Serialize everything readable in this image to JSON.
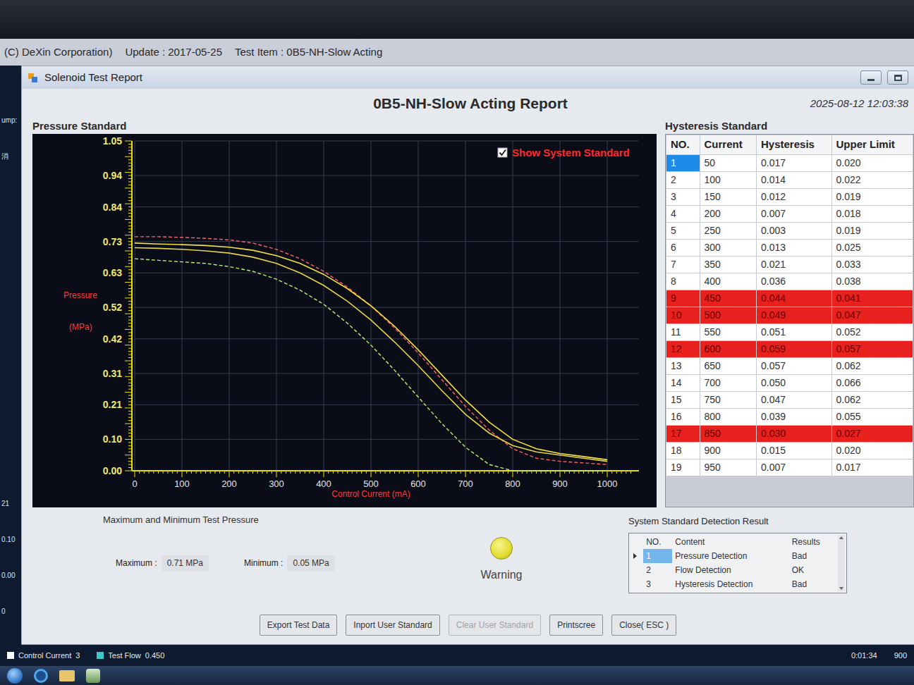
{
  "app_title": [
    "(C) DeXin Corporation)",
    "Update : 2017-05-25",
    "Test Item : 0B5-NH-Slow Acting"
  ],
  "background": {
    "left_top": [
      "ump:",
      "消"
    ],
    "left_bottom": [
      "21",
      "0.10",
      "0.00",
      "0"
    ],
    "legend": [
      {
        "label": "Control Current",
        "value": "3",
        "color": "#ffffff"
      },
      {
        "label": "Test Flow",
        "value": "0.450",
        "color": "#3cc8c8"
      }
    ],
    "right_labels": [
      "0:01:34",
      "900"
    ]
  },
  "window": {
    "title": "Solenoid Test Report"
  },
  "report": {
    "title": "0B5-NH-Slow Acting Report",
    "date": "2025-08-12 12:03:38"
  },
  "chart": {
    "title": "Pressure Standard",
    "y_label": [
      "Pressure",
      "(MPa)"
    ],
    "x_label": "Control Current (mA)",
    "y_ticks": [
      "1.05",
      "0.94",
      "0.84",
      "0.73",
      "0.63",
      "0.52",
      "0.42",
      "0.31",
      "0.21",
      "0.10",
      "0.00"
    ],
    "x_ticks": [
      "0",
      "100",
      "200",
      "300",
      "400",
      "500",
      "600",
      "700",
      "800",
      "900",
      "1000"
    ],
    "checkbox": {
      "label": "Show System Standard",
      "checked": true
    },
    "x_values": [
      0,
      50,
      100,
      150,
      200,
      250,
      300,
      350,
      400,
      450,
      500,
      550,
      600,
      650,
      700,
      750,
      800,
      850,
      900,
      950,
      1000
    ],
    "series": [
      {
        "kind": "dashed",
        "color": "#ff6060",
        "values": [
          0.745,
          0.745,
          0.743,
          0.74,
          0.735,
          0.725,
          0.705,
          0.675,
          0.635,
          0.585,
          0.525,
          0.455,
          0.375,
          0.29,
          0.205,
          0.13,
          0.07,
          0.04,
          0.03,
          0.025,
          0.02
        ]
      },
      {
        "kind": "solid",
        "color": "#f0e040",
        "values": [
          0.725,
          0.722,
          0.72,
          0.717,
          0.712,
          0.702,
          0.685,
          0.66,
          0.625,
          0.58,
          0.525,
          0.46,
          0.385,
          0.305,
          0.225,
          0.155,
          0.1,
          0.07,
          0.055,
          0.045,
          0.035
        ]
      },
      {
        "kind": "solid",
        "color": "#e4d44c",
        "values": [
          0.71,
          0.708,
          0.705,
          0.7,
          0.693,
          0.68,
          0.66,
          0.63,
          0.59,
          0.54,
          0.48,
          0.41,
          0.335,
          0.255,
          0.18,
          0.12,
          0.08,
          0.06,
          0.05,
          0.04,
          0.03
        ]
      },
      {
        "kind": "dashed",
        "color": "#b8f070",
        "values": [
          0.675,
          0.67,
          0.665,
          0.66,
          0.65,
          0.635,
          0.61,
          0.575,
          0.53,
          0.47,
          0.4,
          0.32,
          0.235,
          0.15,
          0.075,
          0.02,
          0,
          0,
          0,
          0,
          0
        ]
      }
    ]
  },
  "hysteresis": {
    "title": "Hysteresis Standard",
    "columns": [
      "NO.",
      "Current",
      "Hysteresis",
      "Upper Limit"
    ],
    "rows": [
      {
        "no": "1",
        "current": "50",
        "hysteresis": "0.017",
        "upper_limit": "0.020",
        "failed": false,
        "selected": true
      },
      {
        "no": "2",
        "current": "100",
        "hysteresis": "0.014",
        "upper_limit": "0.022",
        "failed": false,
        "selected": false
      },
      {
        "no": "3",
        "current": "150",
        "hysteresis": "0.012",
        "upper_limit": "0.019",
        "failed": false,
        "selected": false
      },
      {
        "no": "4",
        "current": "200",
        "hysteresis": "0.007",
        "upper_limit": "0.018",
        "failed": false,
        "selected": false
      },
      {
        "no": "5",
        "current": "250",
        "hysteresis": "0.003",
        "upper_limit": "0.019",
        "failed": false,
        "selected": false
      },
      {
        "no": "6",
        "current": "300",
        "hysteresis": "0.013",
        "upper_limit": "0.025",
        "failed": false,
        "selected": false
      },
      {
        "no": "7",
        "current": "350",
        "hysteresis": "0.021",
        "upper_limit": "0.033",
        "failed": false,
        "selected": false
      },
      {
        "no": "8",
        "current": "400",
        "hysteresis": "0.036",
        "upper_limit": "0.038",
        "failed": false,
        "selected": false
      },
      {
        "no": "9",
        "current": "450",
        "hysteresis": "0.044",
        "upper_limit": "0.041",
        "failed": true,
        "selected": false
      },
      {
        "no": "10",
        "current": "500",
        "hysteresis": "0.049",
        "upper_limit": "0.047",
        "failed": true,
        "selected": false
      },
      {
        "no": "11",
        "current": "550",
        "hysteresis": "0.051",
        "upper_limit": "0.052",
        "failed": false,
        "selected": false
      },
      {
        "no": "12",
        "current": "600",
        "hysteresis": "0.059",
        "upper_limit": "0.057",
        "failed": true,
        "selected": false
      },
      {
        "no": "13",
        "current": "650",
        "hysteresis": "0.057",
        "upper_limit": "0.062",
        "failed": false,
        "selected": false
      },
      {
        "no": "14",
        "current": "700",
        "hysteresis": "0.050",
        "upper_limit": "0.066",
        "failed": false,
        "selected": false
      },
      {
        "no": "15",
        "current": "750",
        "hysteresis": "0.047",
        "upper_limit": "0.062",
        "failed": false,
        "selected": false
      },
      {
        "no": "16",
        "current": "800",
        "hysteresis": "0.039",
        "upper_limit": "0.055",
        "failed": false,
        "selected": false
      },
      {
        "no": "17",
        "current": "850",
        "hysteresis": "0.030",
        "upper_limit": "0.027",
        "failed": true,
        "selected": false
      },
      {
        "no": "18",
        "current": "900",
        "hysteresis": "0.015",
        "upper_limit": "0.020",
        "failed": false,
        "selected": false
      },
      {
        "no": "19",
        "current": "950",
        "hysteresis": "0.007",
        "upper_limit": "0.017",
        "failed": false,
        "selected": false
      }
    ]
  },
  "pressure_summary": {
    "title": "Maximum and Minimum Test Pressure",
    "maximum": {
      "label": "Maximum :",
      "value": "0.71 MPa"
    },
    "minimum": {
      "label": "Minimum :",
      "value": "0.05 MPa"
    }
  },
  "status": {
    "label": "Warning"
  },
  "detection": {
    "title": "System Standard Detection Result",
    "columns": [
      "NO.",
      "Content",
      "Results"
    ],
    "rows": [
      {
        "no": "1",
        "content": "Pressure Detection",
        "result": "Bad",
        "selected": true
      },
      {
        "no": "2",
        "content": "Flow Detection",
        "result": "OK",
        "selected": false
      },
      {
        "no": "3",
        "content": "Hysteresis Detection",
        "result": "Bad",
        "selected": false
      }
    ]
  },
  "buttons": [
    {
      "label": "Export Test Data",
      "disabled": false
    },
    {
      "label": "Inport User Standard",
      "disabled": false
    },
    {
      "label": "Clear User Standard",
      "disabled": true
    },
    {
      "label": "Printscree",
      "disabled": false
    },
    {
      "label": "Close( ESC )",
      "disabled": false
    }
  ]
}
